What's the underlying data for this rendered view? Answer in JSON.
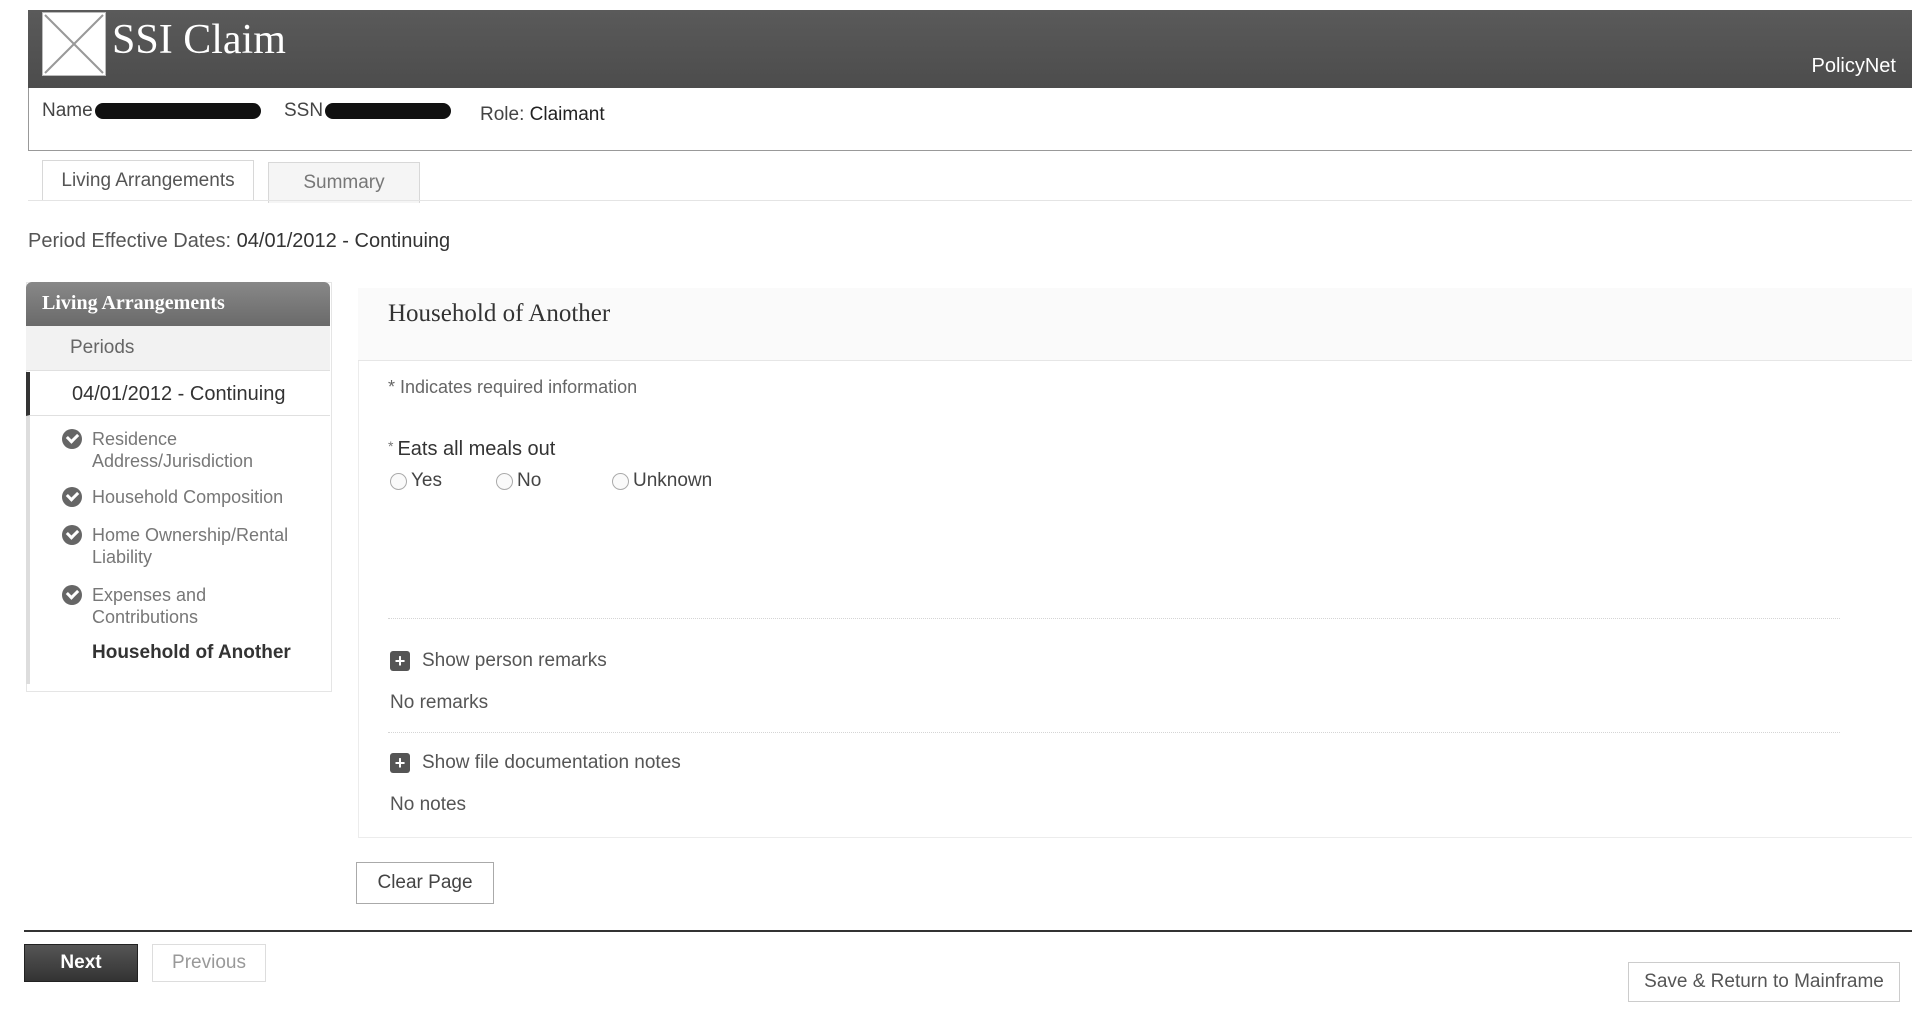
{
  "header": {
    "app_title": "SSI Claim",
    "brand": "PolicyNet",
    "logo_icon": "placeholder-image-icon"
  },
  "claimant": {
    "name_label": "Name",
    "ssn_label": "SSN",
    "role_label": "Role:",
    "role_value": "Claimant"
  },
  "tabs": [
    {
      "label": "Living Arrangements",
      "active": true
    },
    {
      "label": "Summary",
      "active": false
    }
  ],
  "period": {
    "label": "Period Effective Dates:",
    "value": "04/01/2012 - Continuing"
  },
  "sidebar": {
    "header": "Living Arrangements",
    "periods_label": "Periods",
    "selected_period": "04/01/2012 - Continuing",
    "items": [
      {
        "label": "Residence Address/Jurisdiction",
        "status": "complete",
        "icon": "check-circle-icon"
      },
      {
        "label": "Household Composition",
        "status": "complete",
        "icon": "check-circle-icon"
      },
      {
        "label": "Home Ownership/Rental Liability",
        "status": "complete",
        "icon": "check-circle-icon"
      },
      {
        "label": "Expenses and Contributions",
        "status": "complete",
        "icon": "check-circle-icon"
      }
    ],
    "current_item": "Household of Another"
  },
  "main": {
    "title": "Household of Another",
    "required_note": "* Indicates required information",
    "question": {
      "required_marker": "*",
      "label": "Eats all meals out",
      "options": [
        "Yes",
        "No",
        "Unknown"
      ],
      "selected": null
    },
    "person_remarks_toggle": "Show person remarks",
    "person_remarks_value": "No remarks",
    "file_notes_toggle": "Show file documentation notes",
    "file_notes_value": "No notes",
    "clear_button": "Clear Page"
  },
  "footer": {
    "next_button": "Next",
    "previous_button": "Previous",
    "save_button": "Save & Return to Mainframe"
  },
  "colors": {
    "header_bg": "#4f4f4f",
    "sidebar_header_bg": "#777777",
    "primary_button_bg": "#444444"
  }
}
